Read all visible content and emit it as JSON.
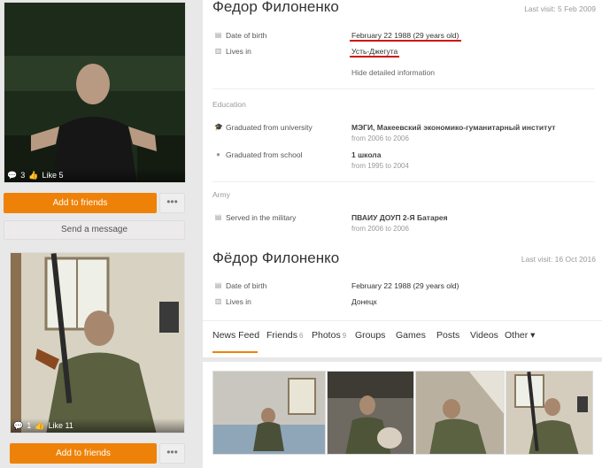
{
  "left": {
    "photo1": {
      "comments": "3",
      "likes": "Like 5"
    },
    "photo2": {
      "comments": "1",
      "likes": "Like 11"
    },
    "add_friends_label": "Add to friends",
    "more_label": "•••",
    "send_message_label": "Send a message"
  },
  "profile1": {
    "name": "Федор Филоненко",
    "last_visit": "Last visit: 5 Feb 2009",
    "dob_label": "Date of birth",
    "dob_value": "February 22 1988 (29 years old)",
    "lives_label": "Lives in",
    "lives_value": "Усть-Джегута",
    "hide_info": "Hide detailed information",
    "education_title": "Education",
    "university_label": "Graduated from university",
    "university_value": "МЭГИ, Макеевский экономико-гуманитарный институт",
    "university_years": "from 2006 to 2006",
    "school_label": "Graduated from school",
    "school_value": "1 школа",
    "school_years": "from 1995 to 2004",
    "army_title": "Army",
    "military_label": "Served in the military",
    "military_value": "ПВАИУ ДОУП 2-Я Батарея",
    "military_years": "from 2006 to 2006"
  },
  "profile2": {
    "name": "Фёдор Филоненко",
    "last_visit": "Last visit: 16 Oct 2016",
    "dob_label": "Date of birth",
    "dob_value": "February 22 1988 (29 years old)",
    "lives_label": "Lives in",
    "lives_value": "Донецк"
  },
  "tabs": [
    {
      "label": "News Feed",
      "count": ""
    },
    {
      "label": "Friends",
      "count": "6"
    },
    {
      "label": "Photos",
      "count": "9"
    },
    {
      "label": "Groups",
      "count": ""
    },
    {
      "label": "Games",
      "count": ""
    },
    {
      "label": "Posts",
      "count": ""
    },
    {
      "label": "Videos",
      "count": ""
    },
    {
      "label": "Other ▾",
      "count": ""
    }
  ],
  "colors": {
    "accent": "#ee8208",
    "highlight": "#d01010"
  }
}
